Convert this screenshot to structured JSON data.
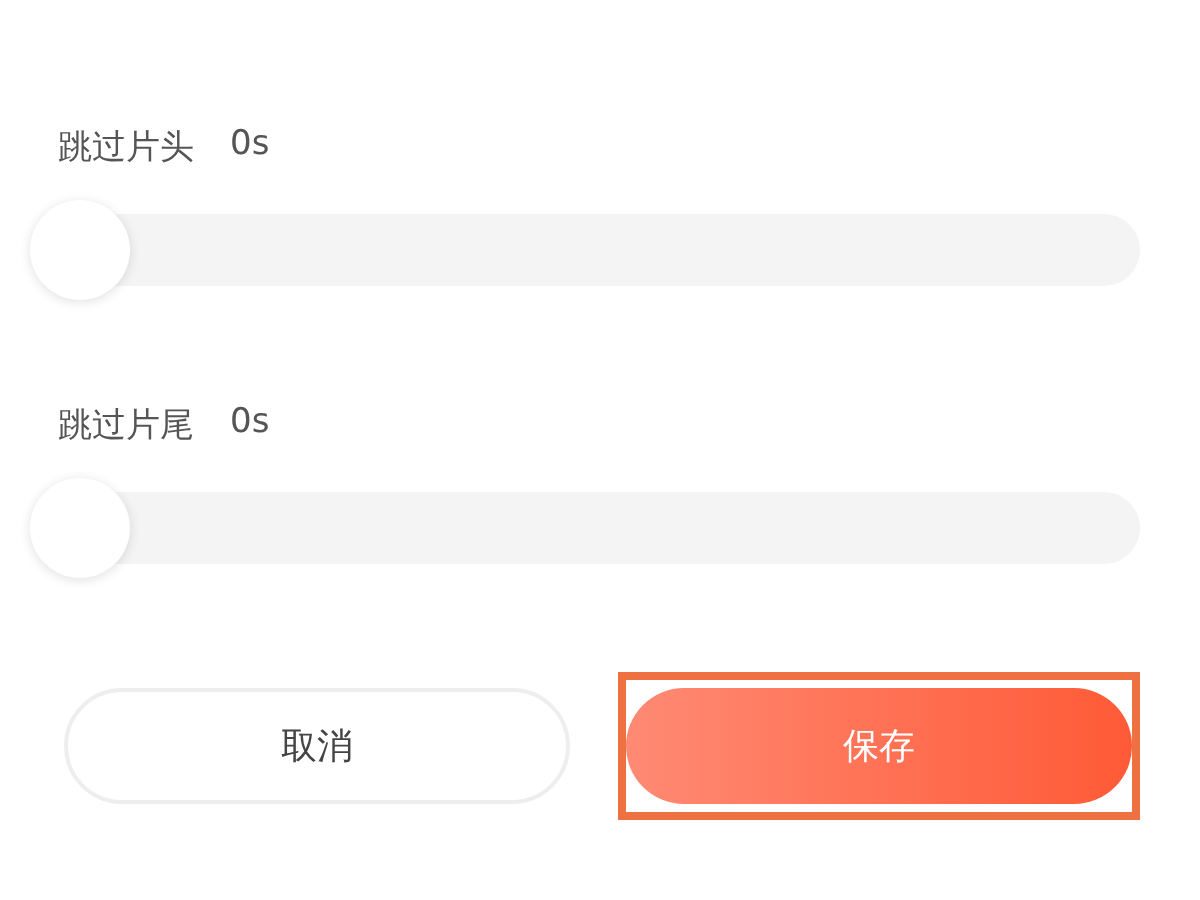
{
  "settings": [
    {
      "label": "跳过片头",
      "value": "0s",
      "level": 0
    },
    {
      "label": "跳过片尾",
      "value": "0s",
      "level": 0
    }
  ],
  "buttons": [
    {
      "label": "取消",
      "kind": "secondary",
      "highlighted": false
    },
    {
      "label": "保存",
      "kind": "primary",
      "highlighted": true
    }
  ]
}
